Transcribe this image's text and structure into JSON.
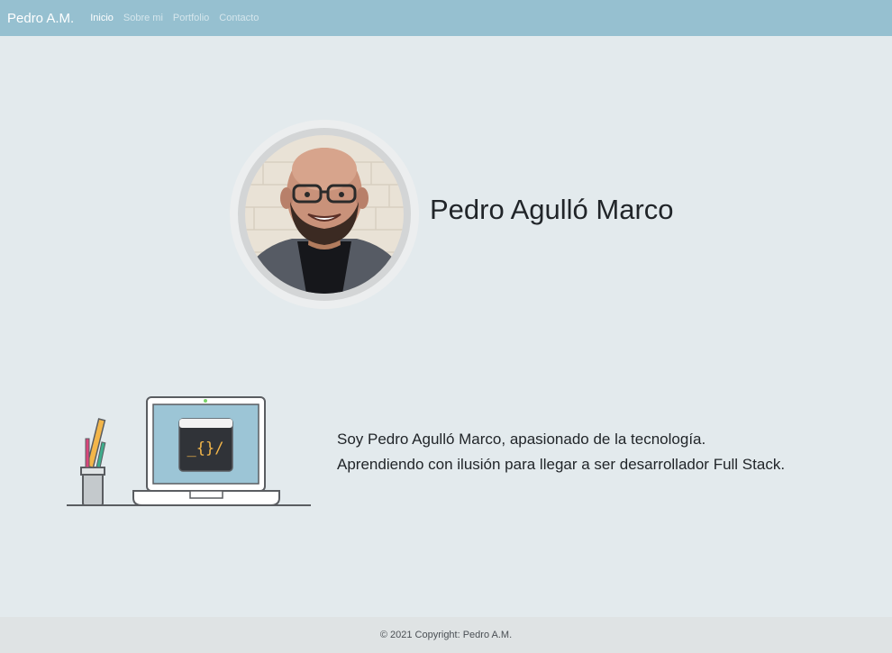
{
  "navbar": {
    "brand": "Pedro A.M.",
    "links": [
      {
        "label": "Inicio",
        "active": true
      },
      {
        "label": "Sobre mi",
        "active": false
      },
      {
        "label": "Portfolio",
        "active": false
      },
      {
        "label": "Contacto",
        "active": false
      }
    ]
  },
  "hero": {
    "name": "Pedro Agulló Marco",
    "avatar_alt": "profile-photo"
  },
  "about": {
    "line1": "Soy Pedro Agulló Marco, apasionado de la tecnología.",
    "line2": "Aprendiendo con ilusión para llegar a ser desarrollador Full Stack.",
    "illustration_code": "_{}/"
  },
  "footer": {
    "copyright": "© 2021 Copyright: Pedro A.M."
  },
  "colors": {
    "navbar": "#96c0d0",
    "background": "#e3eaed",
    "footer": "#dfe3e4",
    "screen": "#9cc5d6"
  }
}
